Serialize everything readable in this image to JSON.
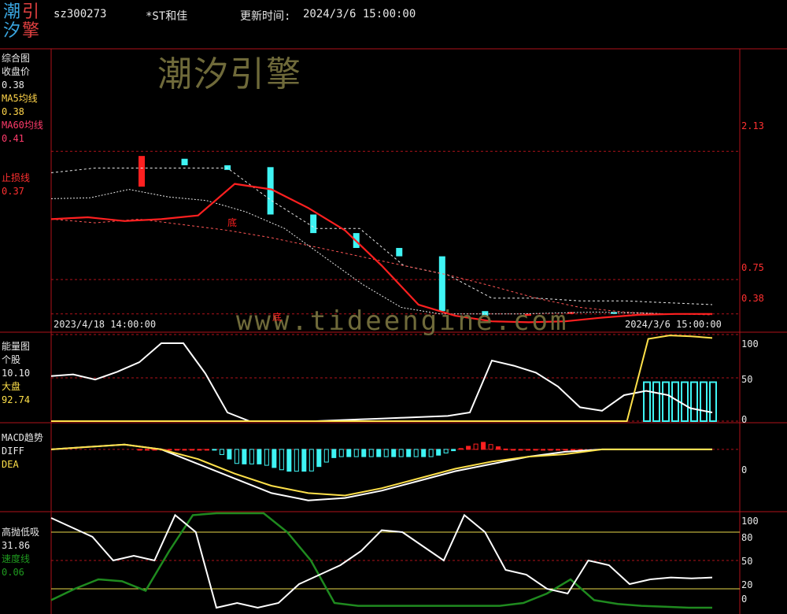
{
  "header": {
    "logo_chars": [
      "潮",
      "引",
      "汐",
      "擎"
    ],
    "code": "sz300273",
    "name": "*ST和佳",
    "update_label": "更新时间:",
    "update_time": "2024/3/6 15:00:00"
  },
  "watermarks": {
    "brand": "潮汐引擎",
    "url": "www.tideengine.com"
  },
  "colors": {
    "up": "#ff2020",
    "down": "#3ff4f4",
    "ma5": "#ffd44a",
    "ma60": "#ff3b6b",
    "grid": "#b0121a",
    "white": "#ffffff",
    "yellow": "#ffe14a",
    "green": "#1f8a1f"
  },
  "panels": {
    "main": {
      "title": "综合图",
      "close_label": "收盘价",
      "close_value": "0.38",
      "ma5_label": "MA5均线",
      "ma5_value": "0.38",
      "ma60_label": "MA60均线",
      "ma60_value": "0.41",
      "stop_label": "止损线",
      "stop_value": "0.37",
      "start_date": "2023/4/18 14:00:00",
      "end_date": "2024/3/6 15:00:00",
      "bottom_marks": [
        "底",
        "底"
      ]
    },
    "energy": {
      "title": "能量图",
      "stock_label": "个股",
      "stock_value": "10.10",
      "market_label": "大盘",
      "market_value": "92.74"
    },
    "macd": {
      "title": "MACD趋势",
      "diff_label": "DIFF",
      "dea_label": "DEA"
    },
    "high_low": {
      "title": "高抛低吸",
      "value": "31.86",
      "speed_label": "速度线",
      "speed_value": "0.06"
    }
  },
  "chart_data": [
    {
      "type": "line",
      "title": "综合图",
      "y_axis_ticks": [
        "2.13",
        "0.75",
        "0.38"
      ],
      "ylim": [
        0.2,
        3.2
      ],
      "x_range": [
        "2023/4/18 14:00:00",
        "2024/3/6 15:00:00"
      ],
      "candles": [
        {
          "o": 1.75,
          "c": 2.08,
          "dir": "up"
        },
        {
          "o": 2.05,
          "c": 1.98,
          "dir": "down"
        },
        {
          "o": 1.98,
          "c": 1.93,
          "dir": "down"
        },
        {
          "o": 1.96,
          "c": 1.45,
          "dir": "down"
        },
        {
          "o": 1.45,
          "c": 1.25,
          "dir": "down"
        },
        {
          "o": 1.25,
          "c": 1.09,
          "dir": "down"
        },
        {
          "o": 1.09,
          "c": 1.0,
          "dir": "down"
        },
        {
          "o": 1.0,
          "c": 0.41,
          "dir": "down"
        },
        {
          "o": 0.41,
          "c": 0.36,
          "dir": "down"
        },
        {
          "o": 0.36,
          "c": 0.38,
          "dir": "up"
        },
        {
          "o": 0.38,
          "c": 0.4,
          "dir": "up"
        },
        {
          "o": 0.4,
          "c": 0.38,
          "dir": "down"
        }
      ],
      "series": [
        {
          "name": "MA5均线",
          "values": [
            1.62,
            1.63,
            1.72,
            1.64,
            1.6,
            1.48,
            1.3,
            1.0,
            0.7,
            0.45,
            0.38,
            0.38,
            0.38,
            0.39,
            0.4,
            0.39,
            0.38,
            0.38
          ]
        },
        {
          "name": "MA60均线",
          "values": [
            1.4,
            1.42,
            1.38,
            1.4,
            1.44,
            1.78,
            1.72,
            1.52,
            1.28,
            0.9,
            0.48,
            0.36,
            0.3,
            0.29,
            0.3,
            0.34,
            0.37,
            0.38,
            0.38
          ]
        },
        {
          "name": "止损线",
          "values": [
            1.4,
            1.36,
            1.4,
            1.34,
            1.28,
            1.2,
            1.1,
            1.0,
            0.9,
            0.8,
            0.68,
            0.55,
            0.45,
            0.4,
            0.38,
            0.37
          ]
        },
        {
          "values": [
            1.9,
            1.95,
            1.95,
            1.95,
            1.95,
            1.6,
            1.3,
            1.3,
            0.9,
            0.8,
            0.55,
            0.55,
            0.52,
            0.52,
            0.5,
            0.48
          ]
        }
      ]
    },
    {
      "type": "line",
      "title": "能量图",
      "y_axis_ticks": [
        "100",
        "50",
        "0"
      ],
      "ylim": [
        0,
        100
      ],
      "series": [
        {
          "name": "个股",
          "values": [
            52,
            54,
            48,
            57,
            68,
            90,
            90,
            55,
            10,
            0,
            0,
            0,
            0,
            1,
            2,
            3,
            4,
            5,
            6,
            10,
            70,
            64,
            56,
            40,
            16,
            12,
            30,
            35,
            30,
            15,
            10
          ]
        },
        {
          "name": "大盘",
          "values": [
            0,
            0,
            0,
            0,
            0,
            0,
            0,
            0,
            0,
            0,
            0,
            0,
            0,
            0,
            0,
            0,
            0,
            0,
            0,
            0,
            0,
            0,
            0,
            0,
            0,
            0,
            0,
            0,
            95,
            99,
            98,
            96
          ]
        },
        {
          "type": "bar",
          "values": [
            45,
            45,
            45,
            45,
            45,
            45,
            45,
            45
          ]
        }
      ]
    },
    {
      "type": "line",
      "title": "MACD趋势",
      "y_axis_ticks": [
        "0"
      ],
      "ylim": [
        -0.25,
        0.1
      ],
      "series": [
        {
          "name": "DIFF",
          "values": [
            0.0,
            0.01,
            0.02,
            0.0,
            -0.06,
            -0.12,
            -0.18,
            -0.21,
            -0.2,
            -0.17,
            -0.13,
            -0.09,
            -0.06,
            -0.03,
            -0.01,
            0.0,
            0.0,
            0.0,
            0.0
          ]
        },
        {
          "name": "DEA",
          "values": [
            0.0,
            0.01,
            0.02,
            0.0,
            -0.04,
            -0.1,
            -0.15,
            -0.18,
            -0.19,
            -0.16,
            -0.12,
            -0.08,
            -0.05,
            -0.03,
            -0.02,
            0.0,
            0.0,
            0.0,
            0.0
          ]
        }
      ]
    },
    {
      "type": "line",
      "title": "高抛低吸",
      "y_axis_ticks": [
        "100",
        "80",
        "50",
        "20",
        "0"
      ],
      "ylim": [
        0,
        100
      ],
      "series": [
        {
          "name": "高抛低吸",
          "values": [
            95,
            85,
            75,
            50,
            55,
            50,
            98,
            80,
            0,
            5,
            0,
            5,
            25,
            35,
            45,
            60,
            82,
            80,
            65,
            50,
            98,
            80,
            40,
            35,
            20,
            15,
            50,
            45,
            25,
            30,
            32,
            31,
            32
          ]
        },
        {
          "name": "速度线",
          "values": [
            8,
            20,
            30,
            28,
            18,
            60,
            98,
            100,
            100,
            100,
            80,
            50,
            5,
            2,
            2,
            2,
            2,
            2,
            2,
            2,
            5,
            15,
            30,
            8,
            4,
            2,
            1,
            0,
            0
          ]
        }
      ]
    }
  ]
}
